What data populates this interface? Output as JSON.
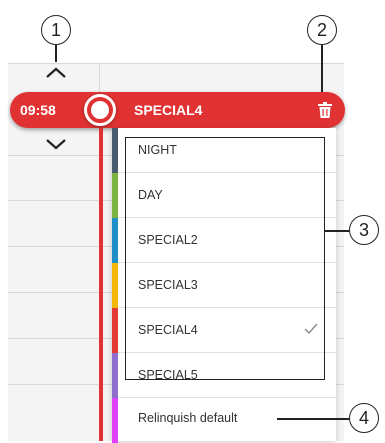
{
  "current_time": "09:58",
  "selected_mode": "SPECIAL4",
  "callouts": [
    "1",
    "2",
    "3",
    "4"
  ],
  "options": [
    {
      "label": "NIGHT",
      "color": "#4a5a6e"
    },
    {
      "label": "DAY",
      "color": "#7cb342"
    },
    {
      "label": "SPECIAL2",
      "color": "#1e90c8"
    },
    {
      "label": "SPECIAL3",
      "color": "#f2b705"
    },
    {
      "label": "SPECIAL4",
      "color": "#e53935",
      "selected": true
    },
    {
      "label": "SPECIAL5",
      "color": "#8e6fd0"
    }
  ],
  "relinquish": {
    "label": "Relinquish default",
    "color": "#e040fb"
  },
  "colors": {
    "accent": "#e03232"
  },
  "icons": [
    "chevron-up-icon",
    "chevron-down-icon",
    "trash-icon",
    "checkmark-icon"
  ]
}
